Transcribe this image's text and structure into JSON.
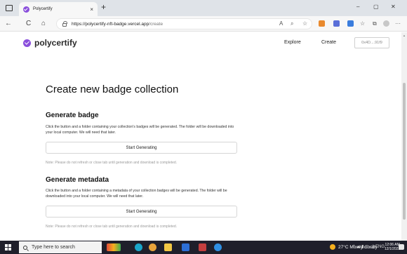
{
  "browser": {
    "tab_title": "Polycertify",
    "tab_close": "×",
    "new_tab": "+",
    "url_host": "https://polycertify-nft-badge.vercel.app",
    "url_path": "/create",
    "minimize": "–",
    "restore": "▢",
    "close": "✕",
    "nav_back": "←",
    "nav_refresh": "C",
    "nav_home": "⌂",
    "tool_read": "A",
    "tool_zoom": "⌕",
    "tool_fav": "☆",
    "tool_favbar": "☆",
    "tool_collections": "⧉",
    "tool_more": "···"
  },
  "site": {
    "logo": "polycertify",
    "nav": [
      "Explore",
      "Create"
    ],
    "wallet": "0x4D....91f9"
  },
  "page": {
    "title": "Create new badge collection",
    "sections": [
      {
        "title": "Generate badge",
        "description": "Click the button and a folder containing your collection's badges will be generated. The folder will be downloaded into your local computer. We will need that later.",
        "button": "Start Generating",
        "note": "Note: Please do not refresh or close tab until generation and download is completed."
      },
      {
        "title": "Generate metadata",
        "description": "Click the button and a folder containing a metadata of your collection badges will be generated. The folder will be downloaded into your local computer. We will need that later.",
        "button": "Start Generating",
        "note": "Note: Please do not refresh or close tab until generation and download is completed."
      }
    ]
  },
  "taskbar": {
    "search_placeholder": "Type here to search",
    "weather": "27°C  Mostly cloudy",
    "tray_icons": "^ ☁ ▮ ◻ ◁) ENG",
    "time": "12:06 AM",
    "date": "12/1/2022"
  },
  "colors": {
    "brand": "#8a4fdc",
    "taskbar": "#1f1f2b"
  }
}
